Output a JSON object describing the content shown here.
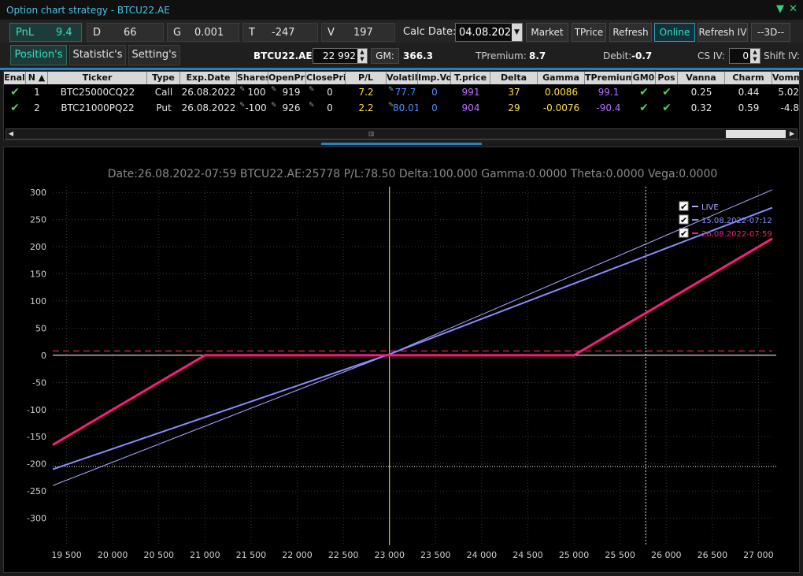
{
  "window": {
    "title": "Option chart strategy - BTCU22.AE"
  },
  "stats": [
    {
      "label": "PnL",
      "value": "9.4"
    },
    {
      "label": "D",
      "value": "66"
    },
    {
      "label": "G",
      "value": "0.001"
    },
    {
      "label": "T",
      "value": "-247"
    },
    {
      "label": "V",
      "value": "197"
    }
  ],
  "toolbar": {
    "calc_date_label": "Calc Date:",
    "calc_date": "04.08.2022",
    "market": "Market",
    "tprice": "TPrice",
    "refresh": "Refresh",
    "online": "Online",
    "refresh_iv": "Refresh IV",
    "view_3d": "--3D--"
  },
  "tabs": [
    {
      "label": "Position's"
    },
    {
      "label": "Statistic's"
    },
    {
      "label": "Setting's"
    }
  ],
  "info": {
    "symbol": "BTCU22.AE",
    "price": "22 992",
    "gm_label": "GM:",
    "gm_value": "366.3",
    "tpremium_label": "TPremium:",
    "tpremium_value": "8.7",
    "debit_label": "Debit:",
    "debit_value": "-0.7",
    "cs_iv_label": "CS IV:",
    "cs_iv_value": "0",
    "shift_iv_label": "Shift IV:"
  },
  "columns": [
    "Enal",
    "N",
    "Ticker",
    "Type",
    "Exp.Date",
    "Shares",
    "OpenPri",
    "ClosePri",
    "P/L",
    "Volatilit",
    "Imp.Vo",
    "T.price",
    "Delta",
    "Gamma",
    "TPremium",
    "GM0",
    "Pos",
    "Vanna",
    "Charm",
    "Vomm"
  ],
  "rows": [
    {
      "n": "1",
      "ticker": "BTC25000CQ22",
      "type": "Call",
      "exp": "26.08.2022",
      "shares": "100",
      "open": "919",
      "close": "0",
      "pl": "7.2",
      "vol": "77.7",
      "impvol": "0",
      "tprice": "991",
      "delta": "37",
      "gamma": "0.0086",
      "tpremium": "99.1",
      "vanna": "0.25",
      "charm": "0.44",
      "vomma": "5.02"
    },
    {
      "n": "2",
      "ticker": "BTC21000PQ22",
      "type": "Put",
      "exp": "26.08.2022",
      "shares": "-100",
      "open": "926",
      "close": "0",
      "pl": "2.2",
      "vol": "80.01",
      "impvol": "0",
      "tprice": "904",
      "delta": "29",
      "gamma": "-0.0076",
      "tpremium": "-90.4",
      "vanna": "0.32",
      "charm": "0.59",
      "vomma": "-4.8"
    }
  ],
  "colors": {
    "accent": "#2a7fbf",
    "live": "#8a8aff",
    "mid": "#aaaaff",
    "expiry": "#ff1a7a",
    "pnl_text": "#39e0c0",
    "pl_yellow": "#ffe040",
    "vol_blue": "#4a8fff",
    "tprice_violet": "#c070ff"
  },
  "chart_data": {
    "type": "line",
    "title": "Date:26.08.2022-07:59  BTCU22.AE:25778  P/L:78.50  Delta:100.000  Gamma:0.0000  Theta:0.0000  Vega:0.0000",
    "xlabel": "",
    "ylabel": "",
    "xlim": [
      19350,
      27150
    ],
    "ylim": [
      -350,
      325
    ],
    "x_ticks": [
      19500,
      20000,
      20500,
      21000,
      21500,
      22000,
      22500,
      23000,
      23500,
      24000,
      24500,
      25000,
      25500,
      26000,
      26500,
      27000
    ],
    "x_tick_labels": [
      "19 500",
      "20 000",
      "20 500",
      "21 000",
      "21 500",
      "22 000",
      "22 500",
      "23 000",
      "23 500",
      "24 000",
      "24 500",
      "25 000",
      "25 500",
      "26 000",
      "26 500",
      "27 000"
    ],
    "y_ticks": [
      300,
      250,
      200,
      150,
      100,
      50,
      0,
      -50,
      -100,
      -150,
      -200,
      -250,
      -300
    ],
    "grid": true,
    "legend_position": "top-right",
    "series": [
      {
        "name": "LIVE",
        "x": [
          19350,
          23000,
          27150
        ],
        "values": [
          -240,
          2,
          305
        ]
      },
      {
        "name": "15.08.2022-07:12",
        "x": [
          19350,
          23000,
          27150
        ],
        "values": [
          -210,
          2,
          272
        ]
      },
      {
        "name": "26.08.2022-07:59",
        "x": [
          19350,
          21000,
          25000,
          27150
        ],
        "values": [
          -165,
          0,
          0,
          215
        ]
      }
    ],
    "reference_lines": {
      "vertical": [
        23000,
        25778
      ],
      "horizontal": [
        0,
        -205
      ],
      "dashed_horizontal": 8
    }
  }
}
